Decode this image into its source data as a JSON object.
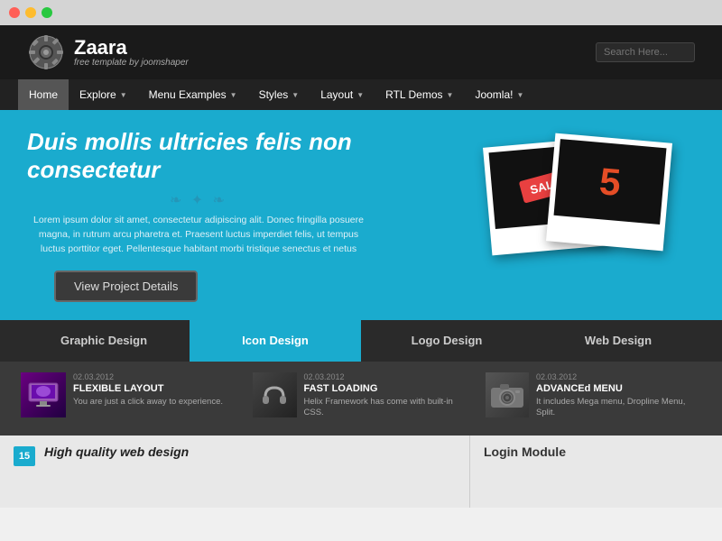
{
  "browser": {
    "dots": [
      "red",
      "yellow",
      "green"
    ]
  },
  "header": {
    "logo_name": "Zaara",
    "logo_tagline": "free template by joomshaper",
    "search_placeholder": "Search Here..."
  },
  "nav": {
    "items": [
      {
        "label": "Home",
        "has_arrow": false
      },
      {
        "label": "Explore",
        "has_arrow": true
      },
      {
        "label": "Menu Examples",
        "has_arrow": true
      },
      {
        "label": "Styles",
        "has_arrow": true
      },
      {
        "label": "Layout",
        "has_arrow": true
      },
      {
        "label": "RTL Demos",
        "has_arrow": true
      },
      {
        "label": "Joomla!",
        "has_arrow": true
      }
    ]
  },
  "hero": {
    "title": "Duis mollis ultricies felis non consectetur",
    "divider": "~~~",
    "description": "Lorem ipsum dolor sit amet, consectetur adipiscing alit. Donec fringilla posuere magna, in rutrum arcu pharetra et. Praesent luctus imperdiet felis, ut tempus luctus porttitor eget. Pellentesque habitant morbi tristique senectus et netus",
    "button_label": "View Project Details"
  },
  "polaroids": {
    "p1_content": "SALE",
    "p2_content": "5"
  },
  "tabs": {
    "items": [
      {
        "label": "Graphic Design",
        "active": false
      },
      {
        "label": "Icon Design",
        "active": true
      },
      {
        "label": "Logo Design",
        "active": false
      },
      {
        "label": "Web Design",
        "active": false
      }
    ]
  },
  "features": [
    {
      "date": "02.03.2012",
      "title": "FLEXIBLE LAYOUT",
      "description": "You are just a click away to experience.",
      "icon_type": "monitor"
    },
    {
      "date": "02.03.2012",
      "title": "FAST LOADING",
      "description": "Helix Framework has come with built-in CSS.",
      "icon_type": "headphones"
    },
    {
      "date": "02.03.2012",
      "title": "ADVANCEd MENU",
      "description": "It includes Mega menu, Dropline Menu, Split.",
      "icon_type": "camera"
    }
  ],
  "bottom": {
    "num": "15",
    "article_title": "High quality web design",
    "login_title": "Login Module"
  }
}
